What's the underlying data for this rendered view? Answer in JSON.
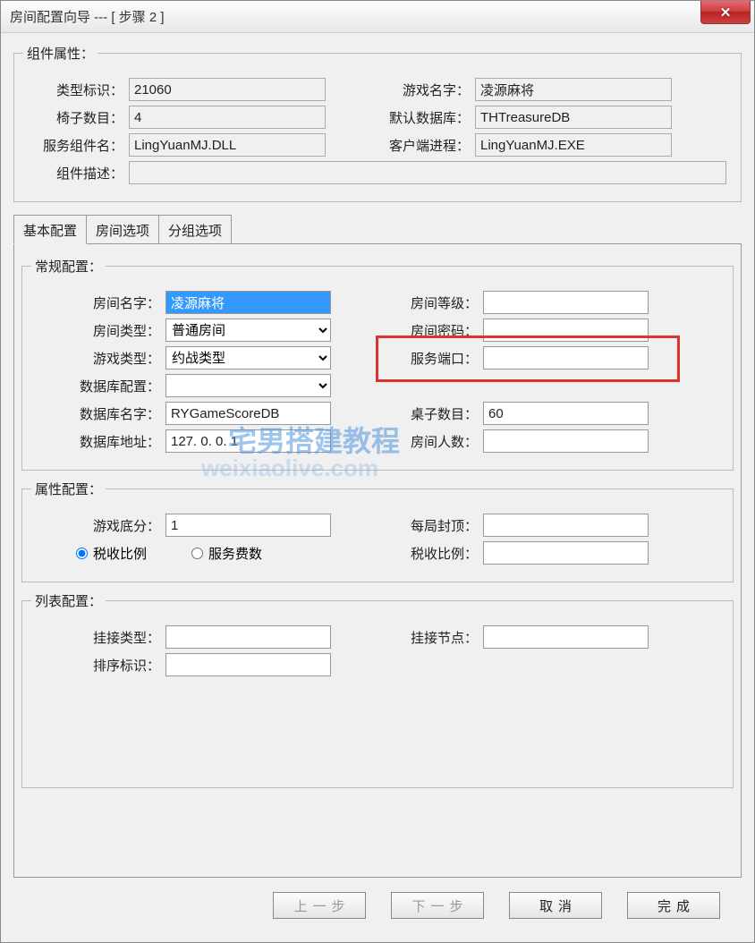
{
  "window": {
    "title": "房间配置向导 --- [ 步骤 2 ]"
  },
  "component_props": {
    "legend": "组件属性：",
    "type_id_label": "类型标识：",
    "type_id": "21060",
    "game_name_label": "游戏名字：",
    "game_name": "凌源麻将",
    "chair_count_label": "椅子数目：",
    "chair_count": "4",
    "default_db_label": "默认数据库：",
    "default_db": "THTreasureDB",
    "svc_component_label": "服务组件名：",
    "svc_component": "LingYuanMJ.DLL",
    "client_proc_label": "客户端进程：",
    "client_proc": "LingYuanMJ.EXE",
    "desc_label": "组件描述：",
    "desc": ""
  },
  "tabs": {
    "basic": "基本配置",
    "room_opts": "房间选项",
    "group_opts": "分组选项"
  },
  "general": {
    "legend": "常规配置：",
    "room_name_label": "房间名字：",
    "room_name": "凌源麻将",
    "room_level_label": "房间等级：",
    "room_level": "",
    "room_type_label": "房间类型：",
    "room_type": "普通房间",
    "room_pwd_label": "房间密码：",
    "room_pwd": "",
    "game_type_label": "游戏类型：",
    "game_type": "约战类型",
    "svc_port_label": "服务端口：",
    "svc_port": "",
    "db_config_label": "数据库配置：",
    "db_config": "",
    "db_name_label": "数据库名字：",
    "db_name": "RYGameScoreDB",
    "table_count_label": "桌子数目：",
    "table_count": "60",
    "db_addr_label": "数据库地址：",
    "db_addr": "127. 0. 0. 1",
    "room_cap_label": "房间人数：",
    "room_cap": ""
  },
  "attr": {
    "legend": "属性配置：",
    "base_score_label": "游戏底分：",
    "base_score": "1",
    "round_cap_label": "每局封顶：",
    "round_cap": "",
    "tax_ratio_radio": "税收比例",
    "service_fee_radio": "服务费数",
    "tax_ratio_label": "税收比例：",
    "tax_ratio": ""
  },
  "list": {
    "legend": "列表配置：",
    "hook_type_label": "挂接类型：",
    "hook_type": "",
    "hook_node_label": "挂接节点：",
    "hook_node": "",
    "sort_id_label": "排序标识：",
    "sort_id": ""
  },
  "buttons": {
    "prev": "上一步",
    "next": "下一步",
    "cancel": "取消",
    "finish": "完成"
  },
  "watermark": {
    "line1": "宅男搭建教程",
    "line2": "weixiaolive.com"
  }
}
